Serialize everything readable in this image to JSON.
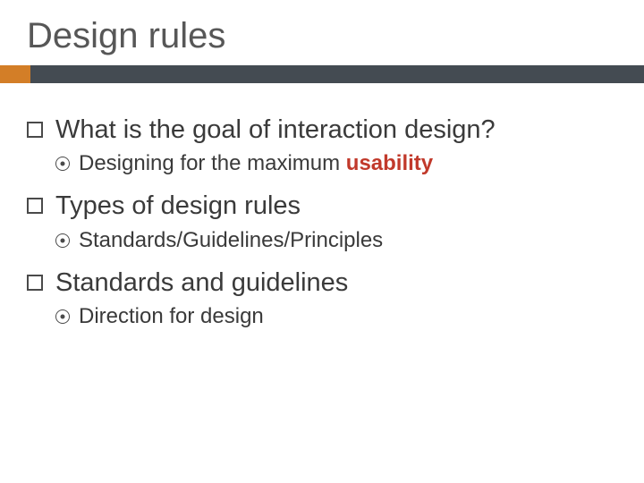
{
  "title": "Design rules",
  "items": [
    {
      "text": "What is the goal of interaction design?",
      "sub": {
        "pre": "Designing for the maximum ",
        "hl": "usability",
        "post": ""
      }
    },
    {
      "text": "Types of design rules",
      "sub": {
        "pre": "Standards/Guidelines/Principles",
        "hl": "",
        "post": ""
      }
    },
    {
      "text": "Standards and guidelines",
      "sub": {
        "pre": "Direction for design",
        "hl": "",
        "post": ""
      }
    }
  ],
  "colors": {
    "accent": "#d37e27",
    "bar": "#444b52",
    "highlight": "#c1392b"
  }
}
